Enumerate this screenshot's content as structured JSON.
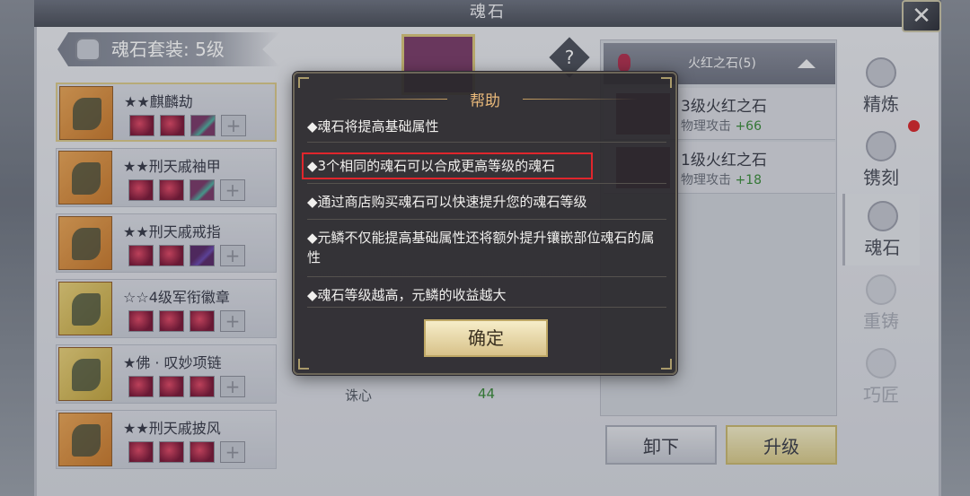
{
  "window": {
    "title": "魂石",
    "close_glyph": "✕"
  },
  "set_header": {
    "label": "魂石套装: 5级"
  },
  "equipment": [
    {
      "name": "★★麒麟劫",
      "gems": [
        "red",
        "red",
        "teal",
        "empty"
      ],
      "selected": true,
      "gold": false
    },
    {
      "name": "★★刑天戚袖甲",
      "gems": [
        "red",
        "red",
        "teal",
        "empty"
      ],
      "selected": false,
      "gold": false
    },
    {
      "name": "★★刑天戚戒指",
      "gems": [
        "red",
        "red",
        "purple",
        "empty"
      ],
      "selected": false,
      "gold": false
    },
    {
      "name": "☆☆4级军衔徽章",
      "gems": [
        "red",
        "red",
        "red",
        "empty"
      ],
      "selected": false,
      "gold": true
    },
    {
      "name": "★佛 · 叹妙项链",
      "gems": [
        "red",
        "red",
        "red",
        "empty"
      ],
      "selected": false,
      "gold": true
    },
    {
      "name": "★★刑天戚披风",
      "gems": [
        "red",
        "red",
        "red",
        "empty"
      ],
      "selected": false,
      "gold": false
    }
  ],
  "help_mark": "?",
  "background_stats": {
    "label": "诛心",
    "value": "44"
  },
  "stone_filter": {
    "label": "火红之石(5)"
  },
  "stones": [
    {
      "name": "3级火红之石",
      "stat_label": "物理攻击",
      "stat_value": "+66"
    },
    {
      "name": "1级火红之石",
      "stat_label": "物理攻击",
      "stat_value": "+18"
    }
  ],
  "actions": {
    "unload": "卸下",
    "upgrade": "升级"
  },
  "side_tabs": [
    {
      "label": "精炼",
      "icon": "refine-icon",
      "state": "normal"
    },
    {
      "label": "镌刻",
      "icon": "engrave-icon",
      "state": "normal"
    },
    {
      "label": "魂石",
      "icon": "soulstone-icon",
      "state": "active"
    },
    {
      "label": "重铸",
      "icon": "recast-icon",
      "state": "dim"
    },
    {
      "label": "巧匠",
      "icon": "artisan-icon",
      "state": "dim"
    }
  ],
  "dialog": {
    "title": "帮助",
    "lines": [
      "◆魂石将提高基础属性",
      "◆3个相同的魂石可以合成更高等级的魂石",
      "◆通过商店购买魂石可以快速提升您的魂石等级",
      "◆元鳞不仅能提高基础属性还将额外提升镶嵌部位魂石的属性",
      "◆魂石等级越高，元鳞的收益越大"
    ],
    "confirm": "确定",
    "highlight_color": "#e0262c"
  }
}
